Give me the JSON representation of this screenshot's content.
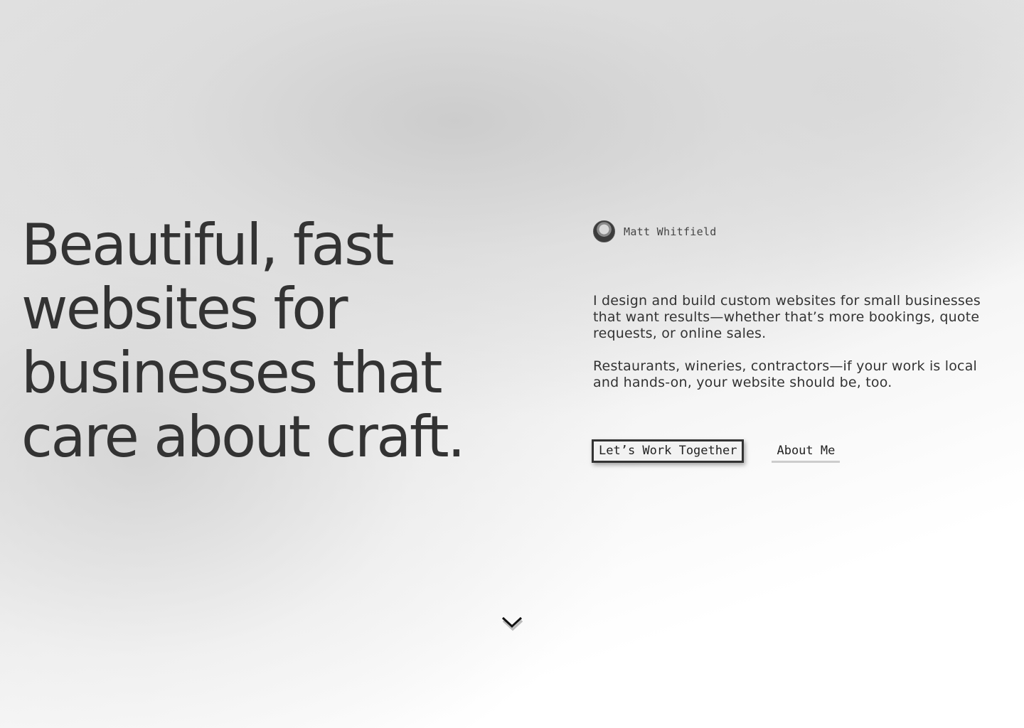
{
  "hero": {
    "headline_lines": [
      "Beautiful, fast",
      "websites for",
      "businesses that",
      "care about craft."
    ]
  },
  "author": {
    "name": "Matt Whitfield",
    "avatar_icon": "avatar-photo"
  },
  "intro": {
    "paragraph_1": "I design and build custom websites for small businesses that want results—whether that’s more bookings, quote requests, or online sales.",
    "paragraph_2": "Restaurants, wineries, contractors—if your work is local and hands-on, your website should be, too."
  },
  "actions": {
    "primary_label": "Let’s Work Together",
    "secondary_label": "About Me"
  },
  "scroll": {
    "icon": "chevron-down-icon"
  },
  "colors": {
    "text": "#333333",
    "button_border": "#333333",
    "underline": "#cccccc"
  }
}
